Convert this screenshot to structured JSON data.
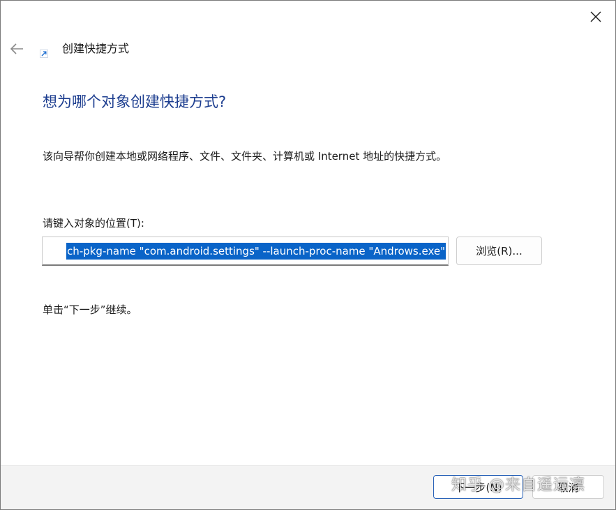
{
  "window": {
    "title": "创建快捷方式"
  },
  "icons": {
    "close": "close-icon",
    "back": "arrow-left-icon",
    "shortcut": "shortcut-arrow-icon"
  },
  "wizard": {
    "heading": "想为哪个对象创建快捷方式?",
    "description": "该向导帮你创建本地或网络程序、文件、文件夹、计算机或 Internet 地址的快捷方式。",
    "location_label": "请键入对象的位置(T):",
    "location_value": "ch-pkg-name \"com.android.settings\" --launch-proc-name \"Androws.exe\"",
    "browse_label": "浏览(R)...",
    "continue_hint": "单击“下一步”继续。"
  },
  "footer": {
    "next_label": "下一步(N)",
    "cancel_label": "取消"
  },
  "watermark": {
    "text": "知乎 @来自遥远凛"
  },
  "colors": {
    "heading": "#1c3d8f",
    "selection": "#0a64c8",
    "accent_border": "#2a63b8",
    "footer_bg": "#f3f3f3"
  }
}
